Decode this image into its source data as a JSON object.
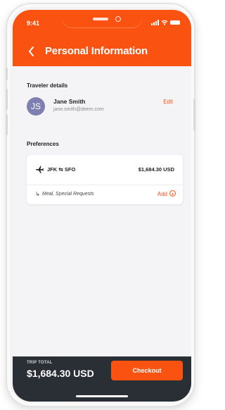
{
  "status_bar": {
    "time": "9:41"
  },
  "header": {
    "title": "Personal Information",
    "back_icon": "chevron-left-icon"
  },
  "traveler": {
    "section_label": "Traveler details",
    "initials": "JS",
    "name": "Jane Smith",
    "email": "jane.smith@deem.com",
    "edit_label": "Edit"
  },
  "preferences": {
    "section_label": "Preferences",
    "flight": {
      "origin": "JFK",
      "swap_icon": "⇆",
      "destination": "SFO",
      "price": "$1,684.30 USD"
    },
    "extras_arrow": "↳",
    "extras_label": "Meal, Special Requests",
    "add_label": "Add",
    "add_icon": "+"
  },
  "footer": {
    "trip_total_label": "TRIP TOTAL",
    "trip_total": "$1,684.30 USD",
    "checkout_label": "Checkout"
  },
  "colors": {
    "accent": "#fa5211",
    "footer_bg": "#2a2e35",
    "avatar_bg": "#7e7fb1",
    "screen_bg": "#f4f4f6"
  }
}
